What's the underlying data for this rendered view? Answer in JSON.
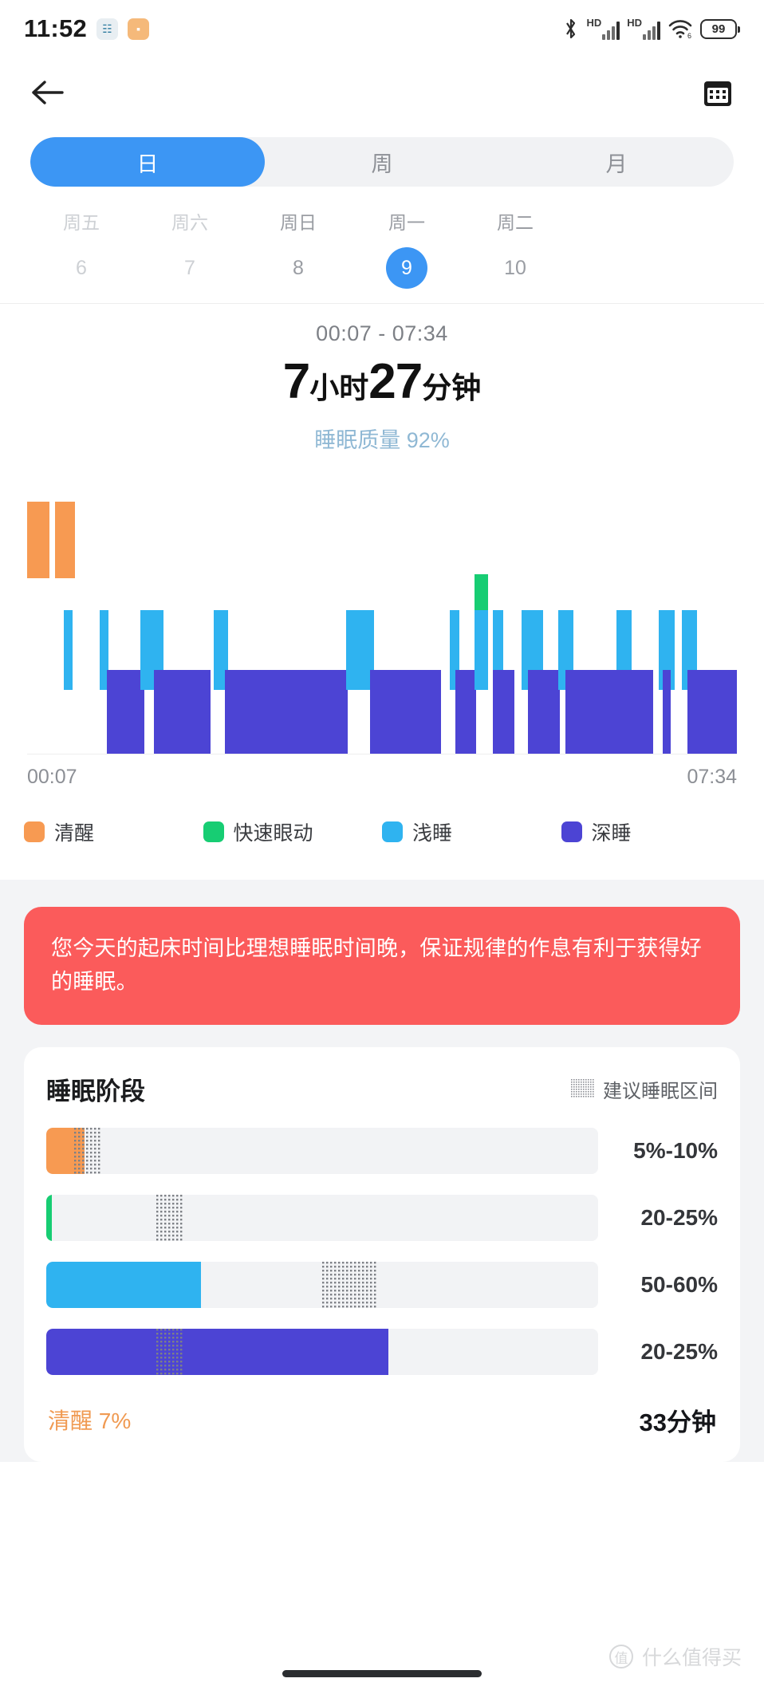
{
  "status_bar": {
    "time": "11:52",
    "app_icon_1": "nfc-icon",
    "app_icon_2": "message-icon",
    "bluetooth": "bluetooth-icon",
    "hd_label_1": "HD",
    "hd_label_2": "HD",
    "wifi_label": "6",
    "battery_level": "99"
  },
  "nav": {
    "back": "back-arrow-icon",
    "calendar": "calendar-icon"
  },
  "period_tabs": [
    {
      "label": "日",
      "active": true
    },
    {
      "label": "周",
      "active": false
    },
    {
      "label": "月",
      "active": false
    }
  ],
  "date_strip": [
    {
      "weekday": "周五",
      "day": "6",
      "selected": false,
      "dim": true
    },
    {
      "weekday": "周六",
      "day": "7",
      "selected": false,
      "dim": true
    },
    {
      "weekday": "周日",
      "day": "8",
      "selected": false,
      "dim": false
    },
    {
      "weekday": "周一",
      "day": "9",
      "selected": true,
      "dim": false
    },
    {
      "weekday": "周二",
      "day": "10",
      "selected": false,
      "dim": false
    }
  ],
  "summary": {
    "time_range": "00:07 - 07:34",
    "hours": "7",
    "hours_unit": "小时",
    "minutes": "27",
    "minutes_unit": "分钟",
    "quality_label": "睡眠质量",
    "quality_value": "92%"
  },
  "chart_data": {
    "type": "bar",
    "title": "睡眠阶段时序图",
    "xlabel": "",
    "ylabel": "",
    "start_time": "00:07",
    "end_time": "07:34",
    "axis_left_label": "00:07",
    "axis_right_label": "07:34",
    "grid": false,
    "legend_position": "bottom",
    "stage_colors": {
      "awake": "#f79a52",
      "rem": "#17cd73",
      "light": "#2fb3f0",
      "deep": "#4c44d4"
    },
    "stage_levels": {
      "awake": 0,
      "rem": 1,
      "light": 2,
      "deep": 3
    },
    "legend": [
      {
        "label": "清醒",
        "color": "#f79a52",
        "key": "awake"
      },
      {
        "label": "快速眼动",
        "color": "#17cd73",
        "key": "rem"
      },
      {
        "label": "浅睡",
        "color": "#2fb3f0",
        "key": "light"
      },
      {
        "label": "深睡",
        "color": "#4c44d4",
        "key": "deep"
      }
    ],
    "segments": [
      {
        "stage": "awake",
        "start_pct": 0.0,
        "width_pct": 3.2
      },
      {
        "stage": "awake",
        "start_pct": 3.9,
        "width_pct": 2.8
      },
      {
        "stage": "light",
        "start_pct": 5.2,
        "width_pct": 1.2
      },
      {
        "stage": "light",
        "start_pct": 10.2,
        "width_pct": 1.3
      },
      {
        "stage": "deep",
        "start_pct": 11.2,
        "width_pct": 5.3
      },
      {
        "stage": "light",
        "start_pct": 15.9,
        "width_pct": 3.3
      },
      {
        "stage": "deep",
        "start_pct": 17.9,
        "width_pct": 8.0
      },
      {
        "stage": "light",
        "start_pct": 26.3,
        "width_pct": 2.0
      },
      {
        "stage": "deep",
        "start_pct": 27.9,
        "width_pct": 17.3
      },
      {
        "stage": "light",
        "start_pct": 44.9,
        "width_pct": 4.0
      },
      {
        "stage": "deep",
        "start_pct": 48.3,
        "width_pct": 10.0
      },
      {
        "stage": "light",
        "start_pct": 59.6,
        "width_pct": 1.3
      },
      {
        "stage": "deep",
        "start_pct": 60.3,
        "width_pct": 3.0
      },
      {
        "stage": "rem",
        "start_pct": 63.0,
        "width_pct": 2.0
      },
      {
        "stage": "light",
        "start_pct": 63.0,
        "width_pct": 2.0
      },
      {
        "stage": "light",
        "start_pct": 65.6,
        "width_pct": 1.5
      },
      {
        "stage": "deep",
        "start_pct": 65.6,
        "width_pct": 3.0
      },
      {
        "stage": "light",
        "start_pct": 69.7,
        "width_pct": 3.0
      },
      {
        "stage": "deep",
        "start_pct": 70.6,
        "width_pct": 4.5
      },
      {
        "stage": "light",
        "start_pct": 74.8,
        "width_pct": 2.2
      },
      {
        "stage": "deep",
        "start_pct": 75.8,
        "width_pct": 7.2
      },
      {
        "stage": "light",
        "start_pct": 83.0,
        "width_pct": 2.2
      },
      {
        "stage": "deep",
        "start_pct": 83.0,
        "width_pct": 5.2
      },
      {
        "stage": "light",
        "start_pct": 89.0,
        "width_pct": 2.2
      },
      {
        "stage": "deep",
        "start_pct": 89.6,
        "width_pct": 1.1
      },
      {
        "stage": "light",
        "start_pct": 92.2,
        "width_pct": 2.2
      },
      {
        "stage": "deep",
        "start_pct": 93.0,
        "width_pct": 7.0
      }
    ]
  },
  "advice": {
    "text": "您今天的起床时间比理想睡眠时间晚，保证规律的作息有利于获得好的睡眠。"
  },
  "stages_card": {
    "title": "睡眠阶段",
    "hint_label": "建议睡眠区间",
    "rows": [
      {
        "key": "awake",
        "color": "#f79a52",
        "value_pct": 7,
        "range_label": "5%-10%",
        "zone_start": 5,
        "zone_end": 10
      },
      {
        "key": "rem",
        "color": "#17cd73",
        "value_pct": 1,
        "range_label": "20-25%",
        "zone_start": 20,
        "zone_end": 25
      },
      {
        "key": "light",
        "color": "#2fb3f0",
        "value_pct": 28,
        "range_label": "50-60%",
        "zone_start": 50,
        "zone_end": 60
      },
      {
        "key": "deep",
        "color": "#4c44d4",
        "value_pct": 62,
        "range_label": "20-25%",
        "zone_start": 20,
        "zone_end": 25
      }
    ],
    "footer_stage": "清醒",
    "footer_pct": "7%",
    "footer_duration": "33分钟"
  },
  "watermark": {
    "badge": "值",
    "text": "什么值得买"
  }
}
